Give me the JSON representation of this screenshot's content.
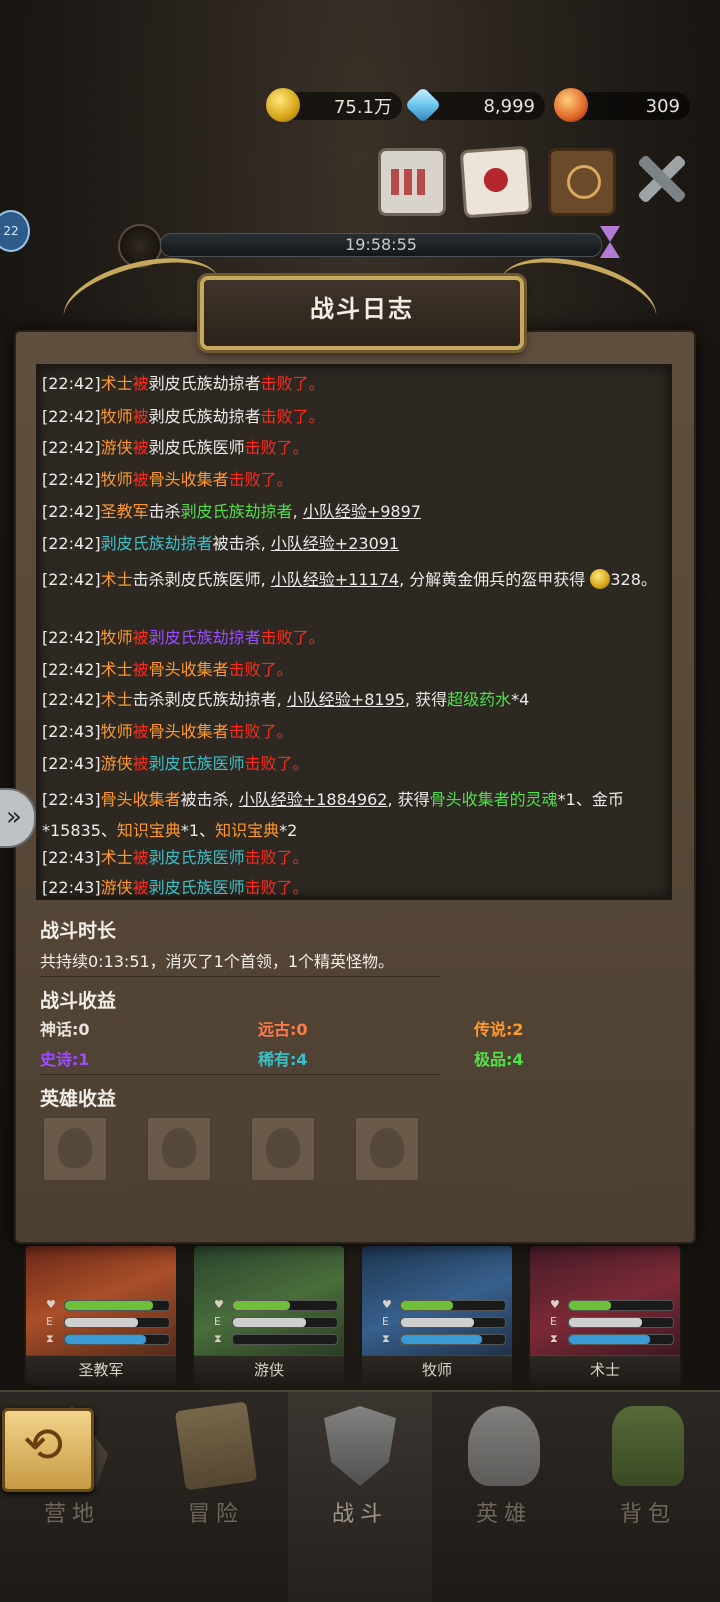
{
  "resources": {
    "gold": "75.1万",
    "gems": "8,999",
    "orbs": "309"
  },
  "level_badge": "22",
  "timer": "19:58:55",
  "dialog_title": "战斗日志",
  "log_lines": [
    {
      "time": "[22:42]",
      "segments": [
        {
          "text": "术士",
          "color": "orange"
        },
        {
          "text": "被",
          "color": "red"
        },
        {
          "text": "剥皮氏族劫掠者",
          "color": "white"
        },
        {
          "text": "击败了。",
          "color": "red"
        }
      ]
    },
    {
      "time": "[22:42]",
      "segments": [
        {
          "text": "牧师",
          "color": "orange"
        },
        {
          "text": "被",
          "color": "red"
        },
        {
          "text": "剥皮氏族劫掠者",
          "color": "white"
        },
        {
          "text": "击败了。",
          "color": "red"
        }
      ]
    },
    {
      "time": "[22:42]",
      "segments": [
        {
          "text": "游侠",
          "color": "orange"
        },
        {
          "text": "被",
          "color": "red"
        },
        {
          "text": "剥皮氏族医师",
          "color": "white"
        },
        {
          "text": "击败了。",
          "color": "red"
        }
      ]
    },
    {
      "time": "[22:42]",
      "segments": [
        {
          "text": "牧师",
          "color": "orange"
        },
        {
          "text": "被",
          "color": "red"
        },
        {
          "text": "骨头收集者",
          "color": "orange"
        },
        {
          "text": "击败了。",
          "color": "red"
        }
      ]
    },
    {
      "time": "[22:42]",
      "segments": [
        {
          "text": "圣教军",
          "color": "orange"
        },
        {
          "text": "击杀",
          "color": "white"
        },
        {
          "text": "剥皮氏族劫掠者",
          "color": "green"
        },
        {
          "text": ", ",
          "color": "white"
        },
        {
          "text": "小队经验+9897",
          "color": "white",
          "underline": true
        }
      ]
    },
    {
      "time": "[22:42]",
      "segments": [
        {
          "text": "剥皮氏族劫掠者",
          "color": "blue"
        },
        {
          "text": "被击杀, ",
          "color": "white"
        },
        {
          "text": "小队经验+23091",
          "color": "white",
          "underline": true
        }
      ]
    },
    {
      "time": "[22:42]",
      "wrap": true,
      "segments": [
        {
          "text": "术士",
          "color": "orange"
        },
        {
          "text": "击杀剥皮氏族医师, ",
          "color": "white"
        },
        {
          "text": "小队经验+11174",
          "color": "white",
          "underline": true
        },
        {
          "text": ", 分解黄金佣兵的盔甲获得 ",
          "color": "white"
        },
        {
          "text": "328。",
          "color": "white",
          "coin": true
        }
      ]
    },
    {
      "time": "[22:42]",
      "segments": [
        {
          "text": "牧师",
          "color": "orange"
        },
        {
          "text": "被",
          "color": "red"
        },
        {
          "text": "剥皮氏族劫掠者",
          "color": "purple"
        },
        {
          "text": "击败了。",
          "color": "red"
        }
      ]
    },
    {
      "time": "[22:42]",
      "segments": [
        {
          "text": "术士",
          "color": "orange"
        },
        {
          "text": "被",
          "color": "red"
        },
        {
          "text": "骨头收集者",
          "color": "orange"
        },
        {
          "text": "击败了。",
          "color": "red"
        }
      ]
    },
    {
      "time": "[22:42]",
      "segments": [
        {
          "text": "术士",
          "color": "orange"
        },
        {
          "text": "击杀剥皮氏族劫掠者, ",
          "color": "white"
        },
        {
          "text": "小队经验+8195",
          "color": "white",
          "underline": true
        },
        {
          "text": ", 获得",
          "color": "white"
        },
        {
          "text": "超级药水",
          "color": "green"
        },
        {
          "text": "*4",
          "color": "white"
        }
      ]
    },
    {
      "time": "[22:43]",
      "segments": [
        {
          "text": "牧师",
          "color": "orange"
        },
        {
          "text": "被",
          "color": "red"
        },
        {
          "text": "骨头收集者",
          "color": "orange"
        },
        {
          "text": "击败了。",
          "color": "red"
        }
      ]
    },
    {
      "time": "[22:43]",
      "segments": [
        {
          "text": "游侠",
          "color": "orange"
        },
        {
          "text": "被",
          "color": "red"
        },
        {
          "text": "剥皮氏族医师",
          "color": "blue"
        },
        {
          "text": "击败了。",
          "color": "red"
        }
      ]
    },
    {
      "time": "[22:43]",
      "wrap": true,
      "segments": [
        {
          "text": "骨头收集者",
          "color": "orange"
        },
        {
          "text": "被击杀, ",
          "color": "white"
        },
        {
          "text": "小队经验+1884962",
          "color": "white",
          "underline": true
        },
        {
          "text": ", 获得",
          "color": "white"
        },
        {
          "text": "骨头收集者的灵魂",
          "color": "green"
        },
        {
          "text": "*1、金币*15835、",
          "color": "white"
        },
        {
          "text": "知识宝典",
          "color": "orange"
        },
        {
          "text": "*1、",
          "color": "white"
        },
        {
          "text": "知识宝典",
          "color": "orange"
        },
        {
          "text": "*2",
          "color": "white"
        }
      ]
    },
    {
      "time": "[22:43]",
      "segments": [
        {
          "text": "术士",
          "color": "orange"
        },
        {
          "text": "被",
          "color": "red"
        },
        {
          "text": "剥皮氏族医师",
          "color": "blue"
        },
        {
          "text": "击败了。",
          "color": "red"
        }
      ]
    },
    {
      "time": "[22:43]",
      "segments": [
        {
          "text": "游侠",
          "color": "orange"
        },
        {
          "text": "被",
          "color": "red"
        },
        {
          "text": "剥皮氏族医师",
          "color": "blue"
        },
        {
          "text": "击败了。",
          "color": "red"
        }
      ]
    }
  ],
  "battle_duration": {
    "title": "战斗时长",
    "text": "共持续0:13:51，消灭了1个首领，1个精英怪物。"
  },
  "battle_rewards": {
    "title": "战斗收益",
    "stats": [
      {
        "label": "神话:0",
        "color": "#e8e4dc"
      },
      {
        "label": "远古:0",
        "color": "#ff7a4a"
      },
      {
        "label": "传说:2",
        "color": "#ff9a2a"
      },
      {
        "label": "史诗:1",
        "color": "#9b4dff"
      },
      {
        "label": "稀有:4",
        "color": "#3cc0c8"
      },
      {
        "label": "极品:4",
        "color": "#4fe04a"
      }
    ]
  },
  "hero_rewards": {
    "title": "英雄收益"
  },
  "hero_cards": [
    {
      "name": "圣教军",
      "hp": 0.85,
      "exp": 0.7,
      "mana": 0.78
    },
    {
      "name": "游侠",
      "hp": 0.55,
      "exp": 0.7,
      "mana": 0.0
    },
    {
      "name": "牧师",
      "hp": 0.5,
      "exp": 0.7,
      "mana": 0.78
    },
    {
      "name": "术士",
      "hp": 0.4,
      "exp": 0.7,
      "mana": 0.78
    }
  ],
  "nav": [
    {
      "label": "营地",
      "icon": "camp-icon"
    },
    {
      "label": "冒险",
      "icon": "map-icon"
    },
    {
      "label": "战斗",
      "icon": "battle-shield-icon",
      "active": true
    },
    {
      "label": "英雄",
      "icon": "helmet-icon"
    },
    {
      "label": "背包",
      "icon": "backpack-icon"
    }
  ],
  "colors": {
    "orange": "#ff9a2a",
    "red": "#ff2a1a",
    "green": "#4fe04a",
    "blue": "#3cc0c8",
    "purple": "#9b4dff",
    "white": "#ecebe7",
    "hp_bar": "#6fbf3a",
    "exp_bar": "#cfcfcf",
    "mana_bar": "#3a9ad6"
  }
}
